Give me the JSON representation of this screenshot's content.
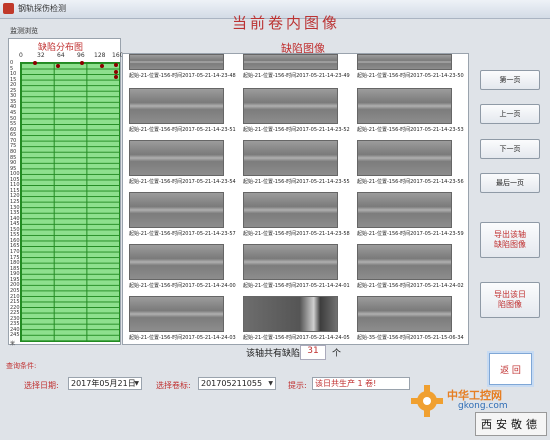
{
  "window": {
    "title": "钢轨探伤检测",
    "heading": "当前卷内图像",
    "subtitle": "监测浏览"
  },
  "defect_map": {
    "title": "缺陷分布图",
    "x_ticks": [
      "0",
      "32",
      "64",
      "96",
      "128",
      "160"
    ],
    "y_ticks": [
      "0",
      "5",
      "10",
      "15",
      "20",
      "25",
      "30",
      "35",
      "40",
      "45",
      "50",
      "55",
      "60",
      "65",
      "70",
      "75",
      "80",
      "85",
      "90",
      "95",
      "100",
      "105",
      "110",
      "115",
      "120",
      "125",
      "130",
      "135",
      "140",
      "145",
      "150",
      "155",
      "160",
      "165",
      "170",
      "175",
      "180",
      "185",
      "190",
      "195",
      "200",
      "205",
      "210",
      "215",
      "220",
      "225",
      "230",
      "235",
      "240",
      "245"
    ],
    "end_label": "米",
    "dots": [
      {
        "x": 25,
        "y": 0
      },
      {
        "x": 104,
        "y": 0
      },
      {
        "x": 64,
        "y": 3
      },
      {
        "x": 136,
        "y": 3
      },
      {
        "x": 160,
        "y": 2
      },
      {
        "x": 160,
        "y": 8
      },
      {
        "x": 160,
        "y": 12
      }
    ]
  },
  "images": {
    "title": "缺陷图像",
    "items": [
      "起始-21-位置-156-时间2017-05-21-14-23-48",
      "起始-21-位置-156-时间2017-05-21-14-23-49",
      "起始-21-位置-156-时间2017-05-21-14-23-50",
      "起始-21-位置-156-时间2017-05-21-14-23-51",
      "起始-21-位置-156-时间2017-05-21-14-23-52",
      "起始-21-位置-156-时间2017-05-21-14-23-53",
      "起始-21-位置-156-时间2017-05-21-14-23-54",
      "起始-21-位置-156-时间2017-05-21-14-23-55",
      "起始-21-位置-156-时间2017-05-21-14-23-56",
      "起始-21-位置-156-时间2017-05-21-14-23-57",
      "起始-21-位置-156-时间2017-05-21-14-23-58",
      "起始-21-位置-156-时间2017-05-21-14-23-59",
      "起始-21-位置-156-时间2017-05-21-14-24-00",
      "起始-21-位置-156-时间2017-05-21-14-24-01",
      "起始-21-位置-156-时间2017-05-21-14-24-02",
      "起始-21-位置-156-时间2017-05-21-14-24-03",
      "起始-21-位置-156-时间2017-05-21-14-24-05",
      "起始-35-位置-156-时间2017-05-21-15-06-34"
    ]
  },
  "buttons": {
    "first": "第一页",
    "prev": "上一页",
    "next": "下一页",
    "last": "最后一页",
    "export_axis": "导出该轴\n缺陷图像",
    "export_day": "导出该日\n陷图像",
    "back": "返 回"
  },
  "count": {
    "prefix": "该轴共有缺陷",
    "value": "31",
    "suffix": "个"
  },
  "query": {
    "label": "查询条件:",
    "date_label": "选择日期:",
    "date_value": "2017年05月21日",
    "volume_label": "选择卷标:",
    "volume_value": "201705211055",
    "tip_label": "提示:",
    "tip_value": "该日共生产 1 卷!"
  },
  "watermark": {
    "text": "中华工控网",
    "site": "gkong.com",
    "logo": "西安敬德"
  },
  "colors": {
    "accent": "#c03030",
    "grid_fill": "#8ee08e",
    "grid_line": "#228b22",
    "dot": "#8b0000"
  }
}
